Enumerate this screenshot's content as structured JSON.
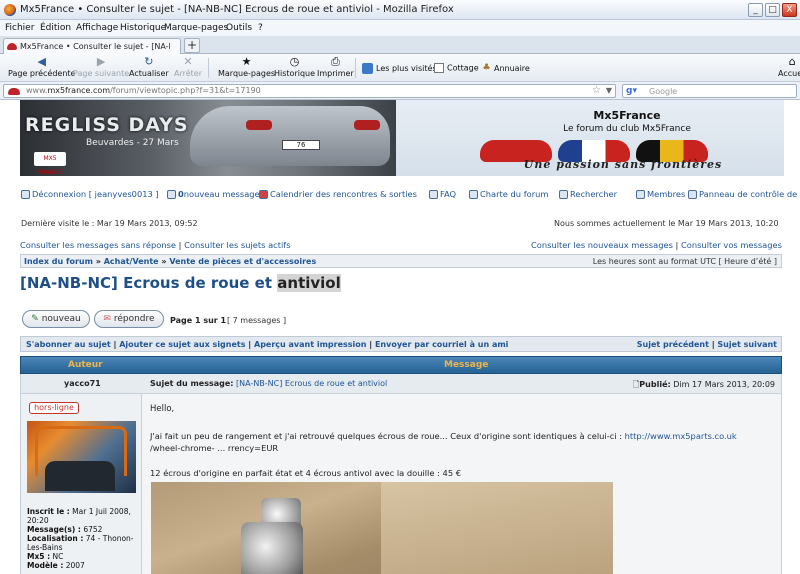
{
  "window": {
    "title": "Mx5France • Consulter le sujet - [NA-NB-NC] Ecrous de roue et antiviol - Mozilla Firefox",
    "buttons": [
      "_",
      "□",
      "X"
    ]
  },
  "menu": [
    "Fichier",
    "Édition",
    "Affichage",
    "Historique",
    "Marque-pages",
    "Outils",
    "?"
  ],
  "tab": {
    "label": "Mx5France • Consulter le sujet - [NA-NB-NC] Ecr..."
  },
  "nav": {
    "back": "Page précédente",
    "forward": "Page suivante",
    "reload": "Actualiser",
    "stop": "Arrêter",
    "bookmarks": "Marque-pages",
    "history": "Historique",
    "print": "Imprimer",
    "most_visited": "Les plus visités",
    "cottage": "Cottage",
    "annuaire": "Annuaire",
    "home": "Accueil"
  },
  "url": {
    "prefix": "www.",
    "domain": "mx5france.com",
    "path": "/forum/viewtopic.php?f=31&t=17190"
  },
  "search": {
    "placeholder": "Google",
    "engine_icon": "google-icon"
  },
  "banner": {
    "event_title": "REGLISS DAYS",
    "event_sub": "Beuvardes - 27 Mars",
    "plate": "76",
    "logo_text": "MX5 FRANCE",
    "site_title": "Mx5France",
    "site_subtitle": "Le forum du club Mx5France",
    "tagline": "Une passion sans frontières",
    "flag_colors": [
      "#c8231e",
      "#1f3f8f",
      "#e8b81a"
    ]
  },
  "toolbar": {
    "logout": "Déconnexion [ jeanyves0013 ]",
    "messages_count": "0",
    "messages_label": "nouveau message",
    "calendar": "Calendrier des rencontres & sorties",
    "faq": "FAQ",
    "charter": "Charte du forum",
    "search": "Rechercher",
    "members": "Membres",
    "control_panel": "Panneau de contrôle de l'utilisateur"
  },
  "visit": {
    "last": "Dernière visite le : Mar 19 Mars 2013, 09:52",
    "now": "Nous sommes actuellement le Mar 19 Mars 2013, 10:20"
  },
  "links": {
    "unanswered": "Consulter les messages sans réponse",
    "active": "Consulter les sujets actifs",
    "new_msgs": "Consulter les nouveaux messages",
    "your_msgs": "Consulter vos messages"
  },
  "breadcrumb": {
    "items": [
      "Index du forum",
      "Achat/Vente",
      "Vente de pièces et d'accessoires"
    ],
    "timezone": "Les heures sont au format UTC [ Heure d’été ]"
  },
  "topic": {
    "title_main": "[NA-NB-NC] Ecrous de roue et",
    "title_highlight": "antiviol",
    "new_btn": "nouveau",
    "reply_btn": "répondre",
    "page": "Page 1 sur 1",
    "count": "[ 7 messages ]"
  },
  "actions": {
    "subscribe": "S'abonner au sujet",
    "bookmark": "Ajouter ce sujet aux signets",
    "print": "Aperçu avant impression",
    "email": "Envoyer par courriel à un ami",
    "prev": "Sujet précédent",
    "next": "Sujet suivant"
  },
  "table": {
    "author_header": "Auteur",
    "message_header": "Message"
  },
  "post": {
    "author": "yacco71",
    "subject_label": "Sujet du message:",
    "subject": "[NA-NB-NC] Ecrous de roue et antiviol",
    "posted_label": "Publié:",
    "posted": "Dim 17 Mars 2013, 20:09",
    "status": "hors-ligne",
    "info": [
      {
        "label": "Inscrit le :",
        "value": "Mar 1 Juil 2008,"
      },
      {
        "label": "",
        "value": "20:20"
      },
      {
        "label": "Message(s) :",
        "value": "6752"
      },
      {
        "label": "Localisation :",
        "value": "74 - Thonon-"
      },
      {
        "label": "",
        "value": "Les-Bains"
      },
      {
        "label": "Mx5 :",
        "value": "NC"
      },
      {
        "label": "Modèle :",
        "value": "2007"
      }
    ],
    "hello": "Hello,",
    "line1": "J'ai fait un peu de rangement et j'ai retrouvé quelques écrous de roue... Ceux d'origine sont identiques à celui-ci :",
    "link1": "http://www.mx5parts.co.uk",
    "link2": "/wheel-chrome- ... rrency=EUR",
    "line2": "12 écrous d'origine en parfait état et 4 écrous antivol avec la douille : 45 €"
  }
}
